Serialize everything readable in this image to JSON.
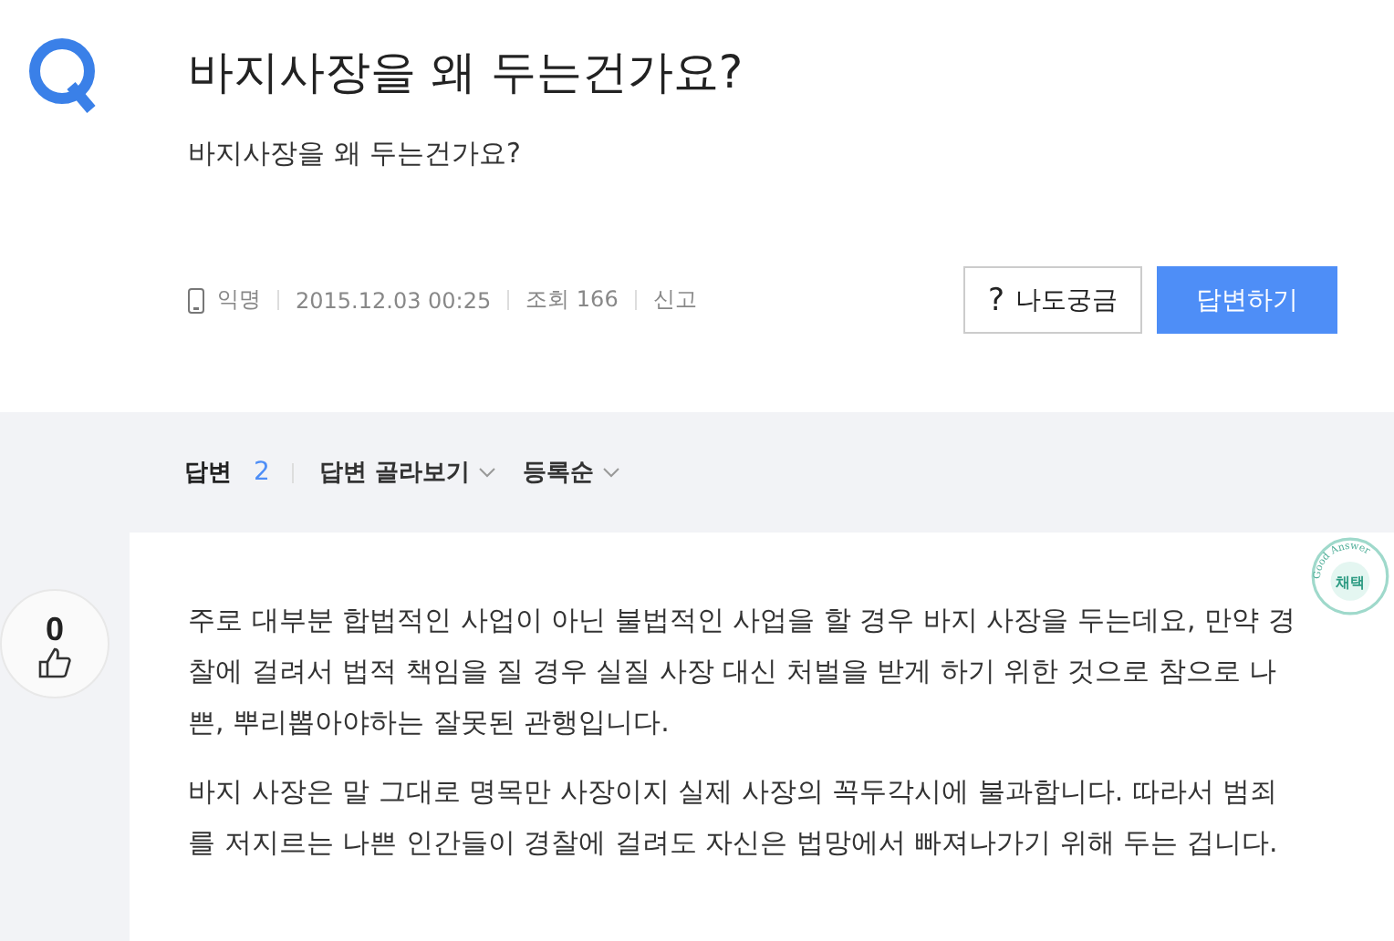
{
  "question": {
    "title": "바지사장을 왜 두는건가요?",
    "body": "바지사장을 왜 두는건가요?",
    "meta": {
      "author": "익명",
      "date": "2015.12.03 00:25",
      "views": "조회 166",
      "report": "신고"
    },
    "buttons": [
      {
        "kind": "secondary",
        "icon": "?",
        "label": "나도궁금"
      },
      {
        "kind": "primary",
        "label": "답변하기"
      }
    ]
  },
  "answer_bar": {
    "label": "답변",
    "count": "2",
    "filters": [
      {
        "label": "답변 골라보기"
      },
      {
        "label": "등록순"
      }
    ]
  },
  "answer": {
    "votes": "0",
    "stamp": {
      "arc": "Good Answer",
      "label": "채택"
    },
    "paragraphs": [
      "주로 대부분 합법적인 사업이 아닌 불법적인 사업을 할 경우 바지 사장을 두는데요, 만약 경찰에 걸려서 법적 책임을 질 경우 실질 사장 대신 처벌을 받게 하기 위한 것으로 참으로 나쁜, 뿌리뽑아야하는 잘못된 관행입니다.",
      "바지 사장은 말 그대로 명목만 사장이지 실제 사장의 꼭두각시에 불과합니다. 따라서 범죄를 저지르는 나쁜 인간들이 경찰에 걸려도 자신은 법망에서 빠져나가기 위해 두는 겁니다."
    ]
  }
}
